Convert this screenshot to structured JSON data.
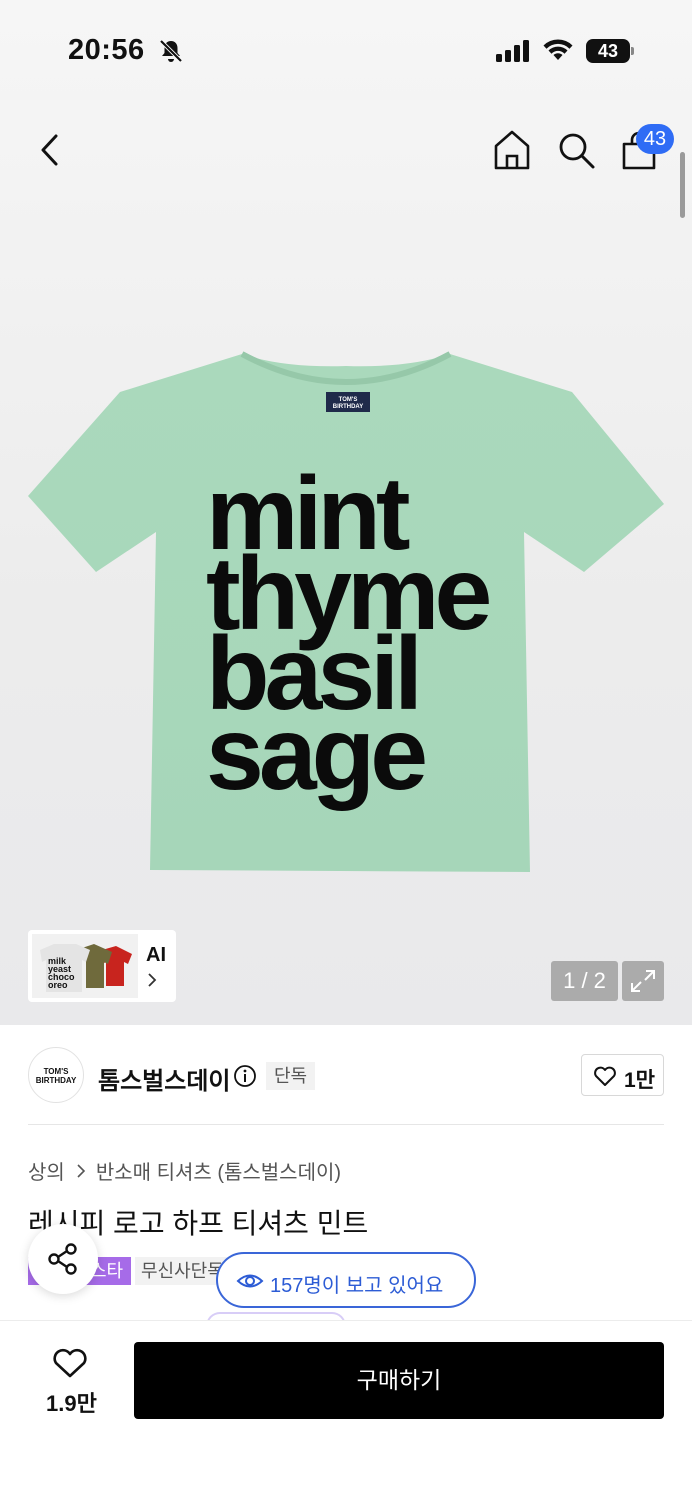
{
  "status": {
    "time": "20:56",
    "battery": "43"
  },
  "nav": {
    "cart_count": "43"
  },
  "hero": {
    "shirt_lines": [
      "mint",
      "thyme",
      "basil",
      "sage"
    ],
    "thumbnail_label": "AI",
    "page_indicator": "1 / 2"
  },
  "brand": {
    "name": "톰스벌스데이",
    "badge": "단독",
    "like_count": "1만",
    "logo_text": "TOM'S BIRTHDAY"
  },
  "breadcrumb": {
    "category": "상의",
    "subcategory": "반소매 티셔츠 (톰스벌스데이)"
  },
  "product": {
    "title": "레시피 로고 하프 티셔츠 민트",
    "tag_purple": "스타",
    "tag_gray": "무신사단독",
    "viewers": "157명이 보고 있어요"
  },
  "bottom": {
    "wish_count": "1.9만",
    "buy_label": "구매하기"
  },
  "colors": {
    "accent_blue": "#2f6cf5",
    "shirt_mint": "#a9d8bb",
    "tag_purple": "#a66be8"
  }
}
